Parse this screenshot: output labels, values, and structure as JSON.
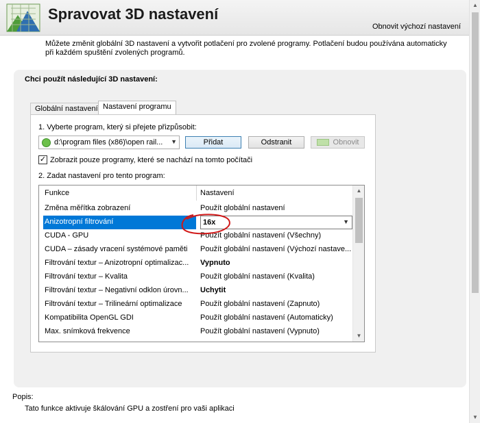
{
  "header": {
    "title": "Spravovat 3D nastavení",
    "restore_link": "Obnovit výchozí nastavení"
  },
  "intro": "Můžete změnit globální 3D nastavení a vytvořit potlačení pro zvolené programy. Potlačení budou používána automaticky při každém spuštění zvolených programů.",
  "panel": {
    "title": "Chci použít následující 3D nastavení:",
    "tabs": [
      {
        "label": "Globální nastavení",
        "active": false
      },
      {
        "label": "Nastavení programu",
        "active": true
      }
    ],
    "step1": "1. Vyberte program, který si přejete přizpůsobit:",
    "program_select": "d:\\program files (x86)\\open rail...",
    "buttons": {
      "add": "Přidat",
      "remove": "Odstranit",
      "restore": "Obnovit"
    },
    "checkbox": {
      "label": "Zobrazit pouze programy, které se nachází na tomto počítači",
      "checked": true,
      "mark": "✓"
    },
    "step2": "2. Zadat nastavení pro tento program:",
    "grid": {
      "headers": [
        "Funkce",
        "Nastavení"
      ],
      "rows": [
        {
          "feature": "Změna měřítka zobrazení",
          "setting": "Použít globální nastavení",
          "bold": false
        },
        {
          "feature": "Anizotropní filtrování",
          "setting": "16x",
          "bold": true,
          "selected": true
        },
        {
          "feature": "CUDA - GPU",
          "setting": "Použít globální nastavení (Všechny)",
          "bold": false
        },
        {
          "feature": "CUDA – zásady vracení systémové paměti",
          "setting": "Použít globální nastavení (Výchozí nastave...",
          "bold": false
        },
        {
          "feature": "Filtrování textur – Anizotropní optimalizac...",
          "setting": "Vypnuto",
          "bold": true
        },
        {
          "feature": "Filtrování textur – Kvalita",
          "setting": "Použít globální nastavení (Kvalita)",
          "bold": false
        },
        {
          "feature": "Filtrování textur – Negativní odklon úrovn...",
          "setting": "Uchytit",
          "bold": true
        },
        {
          "feature": "Filtrování textur – Trilineární optimalizace",
          "setting": "Použít globální nastavení (Zapnuto)",
          "bold": false
        },
        {
          "feature": "Kompatibilita OpenGL GDI",
          "setting": "Použít globální nastavení (Automaticky)",
          "bold": false
        },
        {
          "feature": "Max. snímková frekvence",
          "setting": "Použít globální nastavení (Vypnuto)",
          "bold": false
        }
      ]
    }
  },
  "description": {
    "title": "Popis:",
    "text": "Tato funkce aktivuje škálování GPU a zostření pro vaši aplikaci"
  },
  "icons": {
    "logo": "nvidia-3d-settings-icon",
    "program": "program-icon",
    "dropdown": "chevron-down-icon"
  },
  "colors": {
    "selection": "#0078d7",
    "annotation": "#d01818"
  }
}
